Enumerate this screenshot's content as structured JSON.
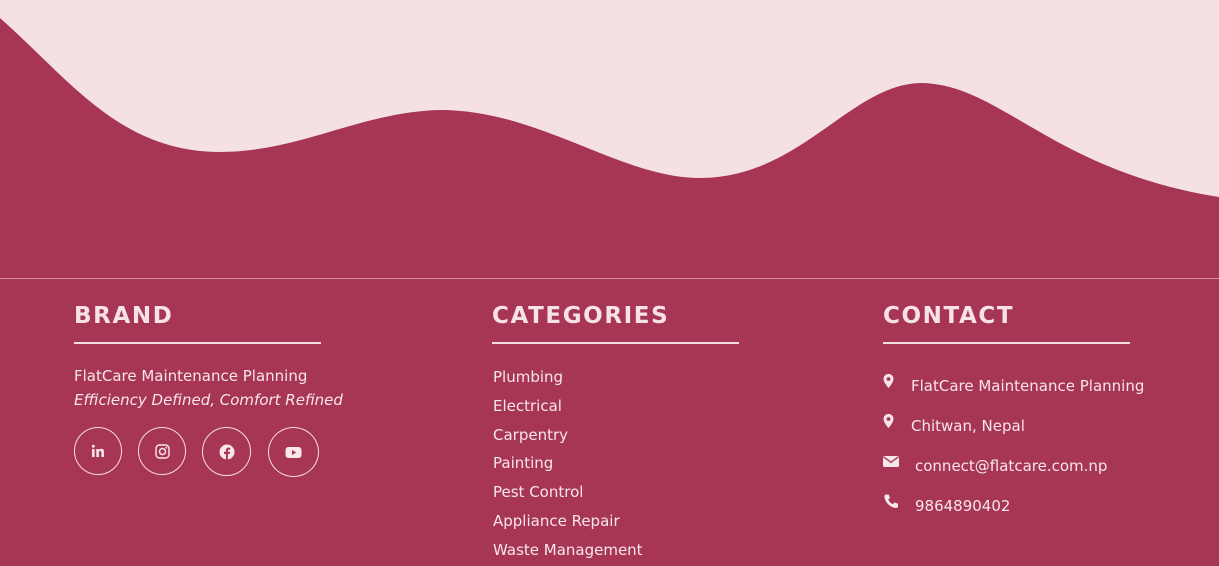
{
  "colors": {
    "footer_bg": "#a73654",
    "wave_light": "#f5e1e4",
    "text": "#f7e6ea"
  },
  "brand": {
    "title": "BRAND",
    "name": "FlatCare Maintenance Planning",
    "tagline": "Efficiency Defined, Comfort Refined",
    "socials": [
      {
        "label": "LinkedIn",
        "icon": "linkedin-icon"
      },
      {
        "label": "Instagram",
        "icon": "instagram-icon"
      },
      {
        "label": "Facebook",
        "icon": "facebook-icon"
      },
      {
        "label": "YouTube",
        "icon": "youtube-icon"
      }
    ]
  },
  "categories": {
    "title": "CATEGORIES",
    "items": [
      "Plumbing",
      "Electrical",
      "Carpentry",
      "Painting",
      "Pest Control",
      "Appliance Repair",
      "Waste Management"
    ]
  },
  "contact": {
    "title": "CONTACT",
    "items": [
      {
        "icon": "map-marker-icon",
        "text": "FlatCare Maintenance Planning"
      },
      {
        "icon": "map-marker-icon",
        "text": "Chitwan, Nepal"
      },
      {
        "icon": "envelope-icon",
        "text": "connect@flatcare.com.np"
      },
      {
        "icon": "phone-icon",
        "text": "9864890402"
      }
    ]
  }
}
